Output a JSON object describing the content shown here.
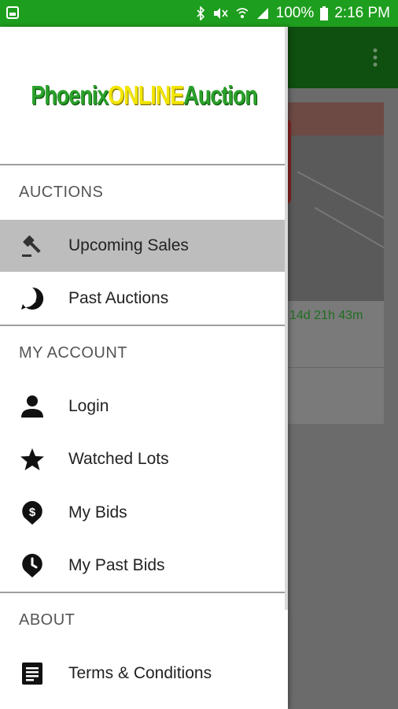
{
  "status_bar": {
    "battery": "100%",
    "time": "2:16 PM",
    "icons": [
      "gallery-icon",
      "bluetooth-icon",
      "mute-icon",
      "wifi-icon",
      "signal-icon",
      "battery-icon"
    ]
  },
  "background_app": {
    "countdown": "14d 21h 43m",
    "overflow_menu_icon": "more-vert-icon"
  },
  "drawer": {
    "logo": {
      "part1": "Phoenix",
      "part2": "ONLINE",
      "part3": "Auction"
    },
    "sections": [
      {
        "title": "AUCTIONS",
        "items": [
          {
            "label": "Upcoming Sales",
            "icon": "gavel-icon",
            "active": true
          },
          {
            "label": "Past Auctions",
            "icon": "dollar-bubble-icon",
            "active": false
          }
        ]
      },
      {
        "title": "MY ACCOUNT",
        "items": [
          {
            "label": "Login",
            "icon": "person-icon",
            "active": false
          },
          {
            "label": "Watched Lots",
            "icon": "star-icon",
            "active": false
          },
          {
            "label": "My Bids",
            "icon": "dollar-pin-icon",
            "active": false
          },
          {
            "label": "My Past Bids",
            "icon": "clock-pin-icon",
            "active": false
          }
        ]
      },
      {
        "title": "ABOUT",
        "items": [
          {
            "label": "Terms & Conditions",
            "icon": "document-icon",
            "active": false
          }
        ]
      }
    ]
  },
  "colors": {
    "status_bar": "#1e9e1e",
    "toolbar": "#0f4f0f",
    "logo_green": "#2aa12a",
    "logo_yellow": "#f2e600",
    "active_item": "#bdbdbd"
  }
}
